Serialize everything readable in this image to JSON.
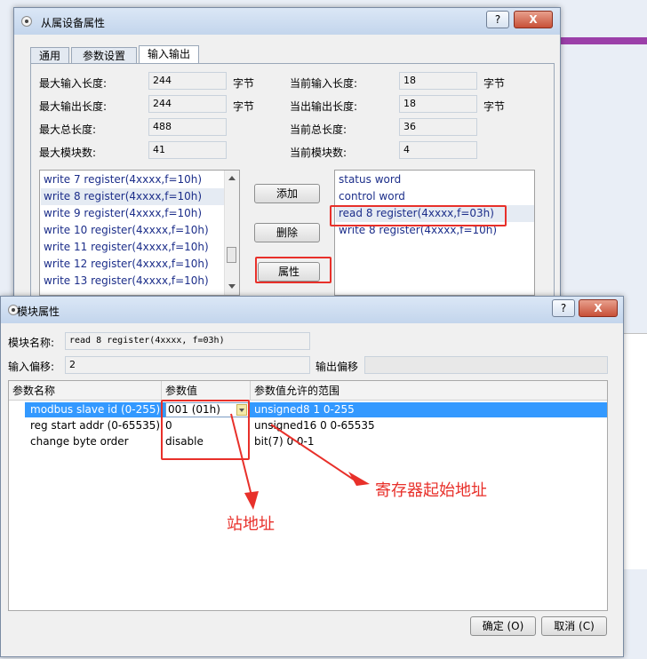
{
  "window1": {
    "title": "从属设备属性",
    "help_btn": "?",
    "close_btn": "X",
    "tabs": [
      "通用",
      "参数设置",
      "输入输出"
    ],
    "fields": {
      "max_input_label": "最大输入长度:",
      "max_input_value": "244",
      "max_output_label": "最大输出长度:",
      "max_output_value": "244",
      "max_total_label": "最大总长度:",
      "max_total_value": "488",
      "max_modules_label": "最大模块数:",
      "max_modules_value": "41",
      "cur_input_label": "当前输入长度:",
      "cur_input_value": "18",
      "cur_output_label": "当出输出长度:",
      "cur_output_value": "18",
      "cur_total_label": "当前总长度:",
      "cur_total_value": "36",
      "cur_modules_label": "当前模块数:",
      "cur_modules_value": "4",
      "unit": "字节"
    },
    "available_modules": [
      "write 7 register(4xxxx,f=10h)",
      "write 8 register(4xxxx,f=10h)",
      "write 9 register(4xxxx,f=10h)",
      "write 10 register(4xxxx,f=10h)",
      "write 11 register(4xxxx,f=10h)",
      "write 12 register(4xxxx,f=10h)",
      "write 13 register(4xxxx,f=10h)"
    ],
    "buttons": {
      "add": "添加",
      "delete": "删除",
      "props": "属性"
    },
    "configured_modules": [
      "status word",
      "control word",
      "read 8 register(4xxxx,f=03h)",
      "write 8 register(4xxxx,f=10h)"
    ]
  },
  "window2": {
    "title": "模块属性",
    "help_btn": "?",
    "close_btn": "X",
    "module_name_label": "模块名称:",
    "module_name_value": "read 8 register(4xxxx, f=03h)",
    "input_offset_label": "输入偏移:",
    "input_offset_value": "2",
    "output_offset_label": "输出偏移",
    "output_offset_value": "",
    "grid_headers": [
      "参数名称",
      "参数值",
      "参数值允许的范围"
    ],
    "rows": [
      {
        "name": "modbus slave id (0-255)",
        "value": "001 (01h)",
        "range": "unsigned8 1 0-255"
      },
      {
        "name": "reg start addr (0-65535)",
        "value": "0",
        "range": "unsigned16 0 0-65535"
      },
      {
        "name": "change byte order",
        "value": "disable",
        "range": "bit(7) 0 0-1"
      }
    ],
    "ok_btn": "确定 (O)",
    "cancel_btn": "取消 (C)"
  },
  "annotations": {
    "station_addr": "站地址",
    "register_start": "寄存器起始地址"
  },
  "colors": {
    "annotation_red": "#e8302a",
    "selection_blue": "#3399ff",
    "list_text": "#1c2e8a",
    "accent_purple": "#9b3fa9"
  }
}
